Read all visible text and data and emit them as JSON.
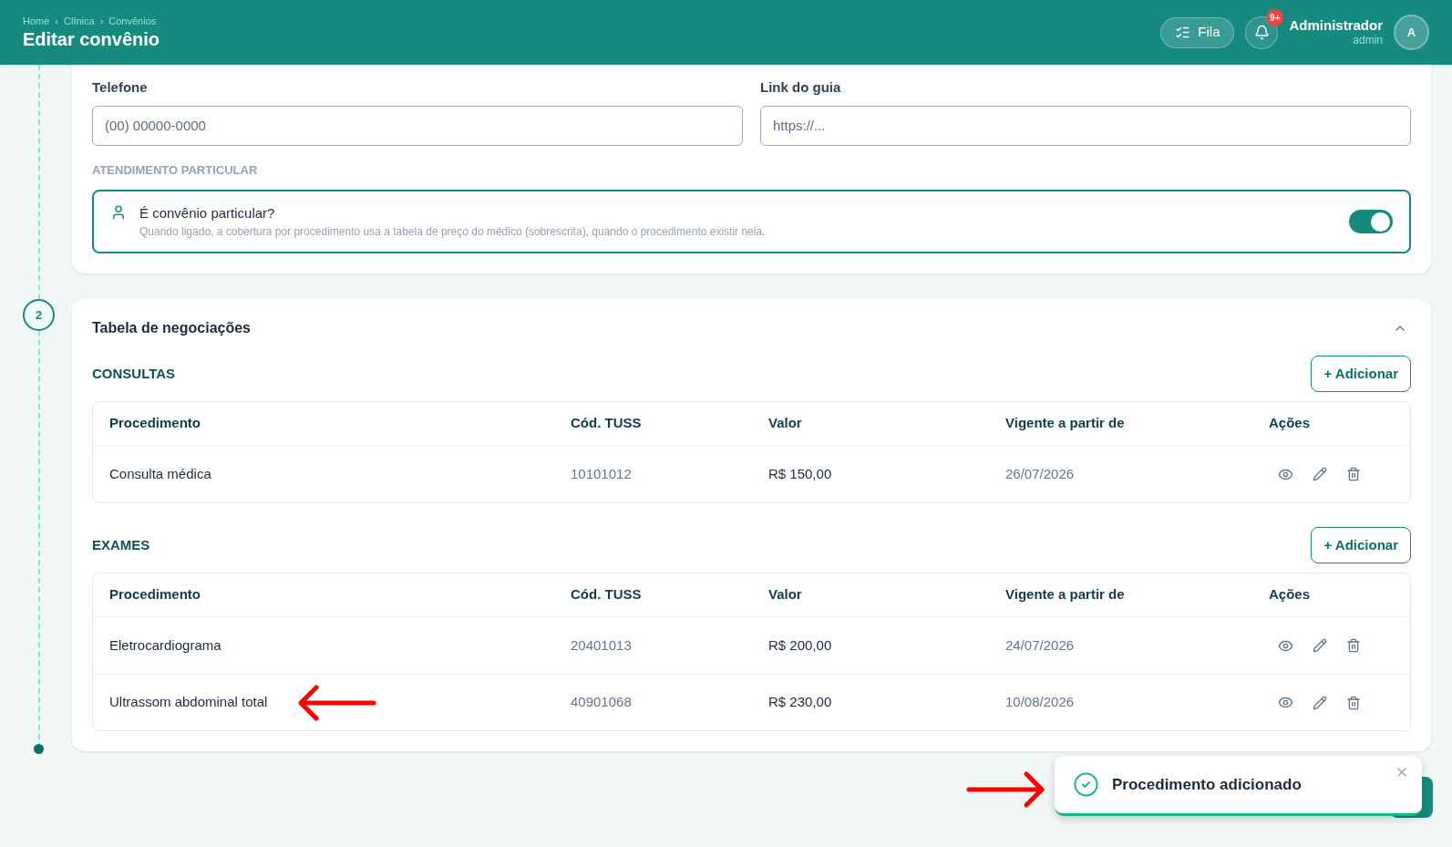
{
  "header": {
    "breadcrumb": [
      "Home",
      "Clínica",
      "Convênios"
    ],
    "separator": "›",
    "title": "Editar convênio",
    "queue_button": "Fila",
    "notification_badge": "9+",
    "user": {
      "name": "Administrador",
      "role": "admin",
      "initial": "A"
    }
  },
  "contact": {
    "fields": [
      {
        "label": "Telefone",
        "placeholder": "(00) 00000-0000"
      },
      {
        "label": "Link do guia",
        "placeholder": "https://..."
      }
    ],
    "section_label": "ATENDIMENTO PARTICULAR",
    "private": {
      "title": "É convênio particular?",
      "description": "Quando ligado, a cobertura por procedimento usa a tabela de preço do médico (sobrescrita), quando o procedimento existir nela.",
      "on": true
    }
  },
  "step": {
    "number": "2",
    "title": "Tabela de negociações",
    "expanded": true
  },
  "sections": [
    {
      "title": "CONSULTAS",
      "add_button": "+ Adicionar",
      "columns": [
        "Procedimento",
        "Cód. TUSS",
        "Valor",
        "Vigente a partir de",
        "Ações"
      ],
      "rows": [
        {
          "procedure": "Consulta médica",
          "tuss": "10101012",
          "value": "R$ 150,00",
          "since": "26/07/2026"
        }
      ]
    },
    {
      "title": "EXAMES",
      "add_button": "+ Adicionar",
      "columns": [
        "Procedimento",
        "Cód. TUSS",
        "Valor",
        "Vigente a partir de",
        "Ações"
      ],
      "rows": [
        {
          "procedure": "Eletrocardiograma",
          "tuss": "20401013",
          "value": "R$ 200,00",
          "since": "24/07/2026"
        },
        {
          "procedure": "Ultrassom abdominal total",
          "tuss": "40901068",
          "value": "R$ 230,00",
          "since": "10/08/2026"
        }
      ]
    }
  ],
  "toast": {
    "message": "Procedimento adicionado"
  }
}
